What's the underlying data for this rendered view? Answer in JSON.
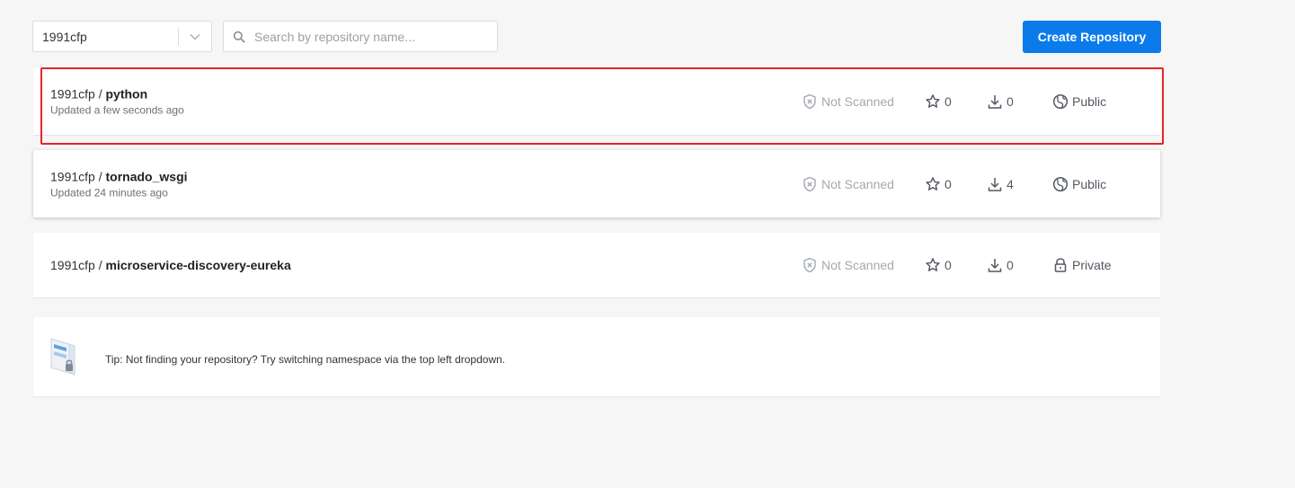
{
  "toolbar": {
    "namespace": "1991cfp",
    "search_placeholder": "Search by repository name...",
    "create_label": "Create Repository"
  },
  "repos": [
    {
      "namespace": "1991cfp",
      "name": "python",
      "updated": "Updated a few seconds ago",
      "scan": "Not Scanned",
      "stars": "0",
      "pulls": "0",
      "visibility": "Public",
      "highlighted": true
    },
    {
      "namespace": "1991cfp",
      "name": "tornado_wsgi",
      "updated": "Updated 24 minutes ago",
      "scan": "Not Scanned",
      "stars": "0",
      "pulls": "4",
      "visibility": "Public"
    },
    {
      "namespace": "1991cfp",
      "name": "microservice-discovery-eureka",
      "updated": "",
      "scan": "Not Scanned",
      "stars": "0",
      "pulls": "0",
      "visibility": "Private"
    }
  ],
  "tip": {
    "text": "Tip: Not finding your repository? Try switching namespace via the top left dropdown."
  },
  "colors": {
    "accent": "#0b7bec",
    "highlight": "#e8232a",
    "background": "#f6f6f6"
  }
}
